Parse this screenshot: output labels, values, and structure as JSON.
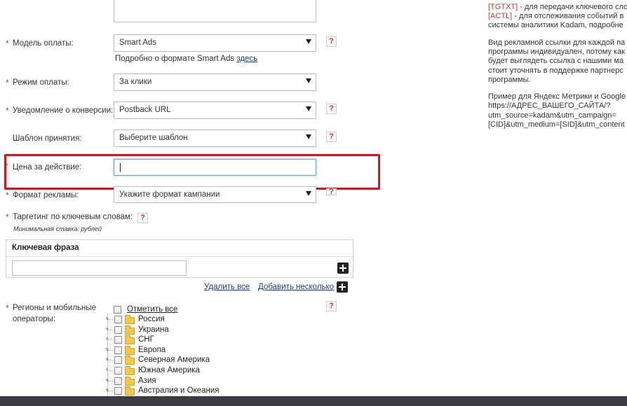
{
  "form": {
    "payment_model": {
      "label": "Модель оплаты:",
      "value": "Smart Ads",
      "hint_text": "Подробно о формате Smart Ads",
      "hint_link": "здесь"
    },
    "payment_mode": {
      "label": "Режим оплаты:",
      "value": "За клики"
    },
    "conversion_notify": {
      "label": "Уведомление о конверсии:",
      "value": "Postback URL"
    },
    "accept_template": {
      "label": "Шаблон принятия:",
      "value": "Выберите шаблон"
    },
    "price_per_action": {
      "label": "Цена за действие:",
      "value": ""
    },
    "ad_format": {
      "label": "Формат рекламы:",
      "value": "Укажите формат кампании"
    },
    "keyword_targeting": {
      "label": "Таргетинг по ключевым словам:",
      "subnote": "Минимальная ставка: рублей"
    },
    "keyword_table": {
      "header": "Ключевая фраза",
      "input_value": ""
    },
    "keyword_actions": {
      "delete_all": "Удалить все",
      "add_several": "Добавить несколько"
    },
    "regions": {
      "label_line1": "Регионы и мобильные",
      "label_line2": "операторы:",
      "check_all": "Отметить все",
      "items": [
        "Россия",
        "Украина",
        "СНГ",
        "Европа",
        "Северная Америка",
        "Южная Америка",
        "Азия",
        "Австралия и Океания"
      ]
    },
    "required_mark": "*",
    "help_mark": "?"
  },
  "sidebar_help": {
    "line1_tag": "[TGTXT]",
    "line1_text": " - для передачи ключевого сло",
    "line2_tag": "[ACTL]",
    "line2_text": " - для отслеживания событий в",
    "line3": "системы аналитики Kadam, подробне",
    "p2_l1": "Вид рекламной ссылки для каждой па",
    "p2_l2": "программы индивидуален, потому как",
    "p2_l3": "будет выглядеть ссылка с нашими ма",
    "p2_l4": "стоит уточнять в поддержке партнерс",
    "p2_l5": "программы.",
    "p3_l1": "Пример для Яндекс Метрики и Google",
    "p3_l2": "https://АДРЕС_ВАШЕГО_САЙТА/?",
    "p3_l3": "utm_source=kadam&utm_campaign=",
    "p3_l4": "[CID]&utm_medium=[SID]&utm_content"
  },
  "colors": {
    "required": "#c0392b",
    "highlight": "#d9121b",
    "link": "#1a3d8f"
  }
}
